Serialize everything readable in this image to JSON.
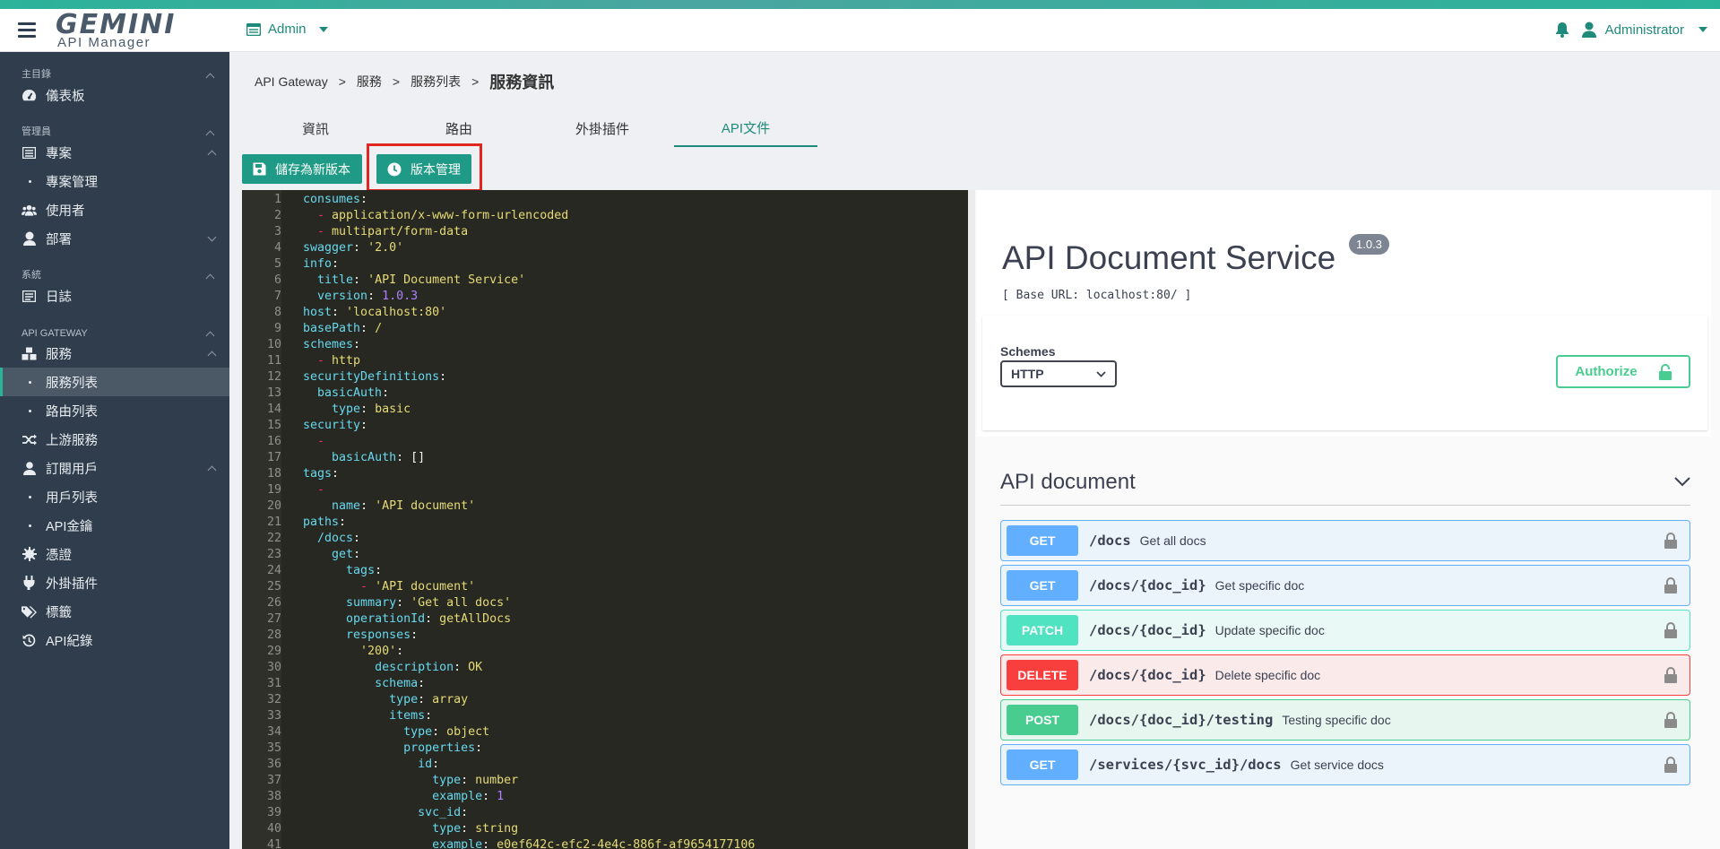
{
  "topbar": {
    "logo_main": "GEMINI",
    "logo_sub": "API Manager",
    "admin_label": "Admin",
    "user_label": "Administrator"
  },
  "sidebar": {
    "sections": [
      {
        "title": "主目錄"
      },
      {
        "title": "管理員"
      },
      {
        "title": "系統"
      },
      {
        "title": "API GATEWAY"
      }
    ],
    "items": {
      "dashboard": "儀表板",
      "projects": "專案",
      "project_mgmt": "專案管理",
      "users": "使用者",
      "departments": "部署",
      "logs": "日誌",
      "services": "服務",
      "service_list": "服務列表",
      "route_list": "路由列表",
      "upstream": "上游服務",
      "subscribers": "訂閱用戶",
      "user_list": "用戶列表",
      "api_key": "API金鑰",
      "certificates": "憑證",
      "plugins": "外掛插件",
      "tags": "標籤",
      "api_records": "API紀錄"
    }
  },
  "breadcrumb": {
    "items": [
      "API Gateway",
      "服務",
      "服務列表"
    ],
    "separator": ">",
    "current": "服務資訊"
  },
  "tabs": [
    "資訊",
    "路由",
    "外掛插件",
    "API文件"
  ],
  "buttons": {
    "save_new_version": "儲存為新版本",
    "version_management": "版本管理"
  },
  "editor": {
    "lines": [
      [
        [
          "k",
          "consumes"
        ],
        [
          "p",
          ":"
        ]
      ],
      [
        [
          "p",
          "  "
        ],
        [
          "dash",
          "- "
        ],
        [
          "s",
          "application/x-www-form-urlencoded"
        ]
      ],
      [
        [
          "p",
          "  "
        ],
        [
          "dash",
          "- "
        ],
        [
          "s",
          "multipart/form-data"
        ]
      ],
      [
        [
          "k",
          "swagger"
        ],
        [
          "p",
          ": "
        ],
        [
          "s",
          "'2.0'"
        ]
      ],
      [
        [
          "k",
          "info"
        ],
        [
          "p",
          ":"
        ]
      ],
      [
        [
          "p",
          "  "
        ],
        [
          "k",
          "title"
        ],
        [
          "p",
          ": "
        ],
        [
          "s",
          "'API Document Service'"
        ]
      ],
      [
        [
          "p",
          "  "
        ],
        [
          "k",
          "version"
        ],
        [
          "p",
          ": "
        ],
        [
          "v",
          "1.0.3"
        ]
      ],
      [
        [
          "k",
          "host"
        ],
        [
          "p",
          ": "
        ],
        [
          "s",
          "'localhost:80'"
        ]
      ],
      [
        [
          "k",
          "basePath"
        ],
        [
          "p",
          ": "
        ],
        [
          "s",
          "/"
        ]
      ],
      [
        [
          "k",
          "schemes"
        ],
        [
          "p",
          ":"
        ]
      ],
      [
        [
          "p",
          "  "
        ],
        [
          "dash",
          "- "
        ],
        [
          "s",
          "http"
        ]
      ],
      [
        [
          "k",
          "securityDefinitions"
        ],
        [
          "p",
          ":"
        ]
      ],
      [
        [
          "p",
          "  "
        ],
        [
          "k",
          "basicAuth"
        ],
        [
          "p",
          ":"
        ]
      ],
      [
        [
          "p",
          "    "
        ],
        [
          "k",
          "type"
        ],
        [
          "p",
          ": "
        ],
        [
          "s",
          "basic"
        ]
      ],
      [
        [
          "k",
          "security"
        ],
        [
          "p",
          ":"
        ]
      ],
      [
        [
          "p",
          "  "
        ],
        [
          "dash",
          "-"
        ]
      ],
      [
        [
          "p",
          "    "
        ],
        [
          "k",
          "basicAuth"
        ],
        [
          "p",
          ": []"
        ]
      ],
      [
        [
          "k",
          "tags"
        ],
        [
          "p",
          ":"
        ]
      ],
      [
        [
          "p",
          "  "
        ],
        [
          "dash",
          "-"
        ]
      ],
      [
        [
          "p",
          "    "
        ],
        [
          "k",
          "name"
        ],
        [
          "p",
          ": "
        ],
        [
          "s",
          "'API document'"
        ]
      ],
      [
        [
          "k",
          "paths"
        ],
        [
          "p",
          ":"
        ]
      ],
      [
        [
          "p",
          "  "
        ],
        [
          "k",
          "/docs"
        ],
        [
          "p",
          ":"
        ]
      ],
      [
        [
          "p",
          "    "
        ],
        [
          "k",
          "get"
        ],
        [
          "p",
          ":"
        ]
      ],
      [
        [
          "p",
          "      "
        ],
        [
          "k",
          "tags"
        ],
        [
          "p",
          ":"
        ]
      ],
      [
        [
          "p",
          "        "
        ],
        [
          "dash",
          "- "
        ],
        [
          "s",
          "'API document'"
        ]
      ],
      [
        [
          "p",
          "      "
        ],
        [
          "k",
          "summary"
        ],
        [
          "p",
          ": "
        ],
        [
          "s",
          "'Get all docs'"
        ]
      ],
      [
        [
          "p",
          "      "
        ],
        [
          "k",
          "operationId"
        ],
        [
          "p",
          ": "
        ],
        [
          "s",
          "getAllDocs"
        ]
      ],
      [
        [
          "p",
          "      "
        ],
        [
          "k",
          "responses"
        ],
        [
          "p",
          ":"
        ]
      ],
      [
        [
          "p",
          "        "
        ],
        [
          "s",
          "'200'"
        ],
        [
          "p",
          ":"
        ]
      ],
      [
        [
          "p",
          "          "
        ],
        [
          "k",
          "description"
        ],
        [
          "p",
          ": "
        ],
        [
          "s",
          "OK"
        ]
      ],
      [
        [
          "p",
          "          "
        ],
        [
          "k",
          "schema"
        ],
        [
          "p",
          ":"
        ]
      ],
      [
        [
          "p",
          "            "
        ],
        [
          "k",
          "type"
        ],
        [
          "p",
          ": "
        ],
        [
          "s",
          "array"
        ]
      ],
      [
        [
          "p",
          "            "
        ],
        [
          "k",
          "items"
        ],
        [
          "p",
          ":"
        ]
      ],
      [
        [
          "p",
          "              "
        ],
        [
          "k",
          "type"
        ],
        [
          "p",
          ": "
        ],
        [
          "s",
          "object"
        ]
      ],
      [
        [
          "p",
          "              "
        ],
        [
          "k",
          "properties"
        ],
        [
          "p",
          ":"
        ]
      ],
      [
        [
          "p",
          "                "
        ],
        [
          "k",
          "id"
        ],
        [
          "p",
          ":"
        ]
      ],
      [
        [
          "p",
          "                  "
        ],
        [
          "k",
          "type"
        ],
        [
          "p",
          ": "
        ],
        [
          "s",
          "number"
        ]
      ],
      [
        [
          "p",
          "                  "
        ],
        [
          "k",
          "example"
        ],
        [
          "p",
          ": "
        ],
        [
          "v",
          "1"
        ]
      ],
      [
        [
          "p",
          "                "
        ],
        [
          "k",
          "svc_id"
        ],
        [
          "p",
          ":"
        ]
      ],
      [
        [
          "p",
          "                  "
        ],
        [
          "k",
          "type"
        ],
        [
          "p",
          ": "
        ],
        [
          "s",
          "string"
        ]
      ],
      [
        [
          "p",
          "                  "
        ],
        [
          "k",
          "example"
        ],
        [
          "p",
          ": "
        ],
        [
          "s",
          "e0ef642c-efc2-4e4c-886f-af9654177106"
        ]
      ]
    ]
  },
  "swagger": {
    "title": "API Document Service",
    "version": "1.0.3",
    "base_url": "[ Base URL: localhost:80/ ]",
    "schemes_label": "Schemes",
    "schemes_value": "HTTP",
    "authorize_label": "Authorize",
    "tag_title": "API document",
    "operations": [
      {
        "method": "GET",
        "path": "/docs",
        "desc": "Get all docs",
        "cls": "get"
      },
      {
        "method": "GET",
        "path": "/docs/{doc_id}",
        "desc": "Get specific doc",
        "cls": "get"
      },
      {
        "method": "PATCH",
        "path": "/docs/{doc_id}",
        "desc": "Update specific doc",
        "cls": "patch"
      },
      {
        "method": "DELETE",
        "path": "/docs/{doc_id}",
        "desc": "Delete specific doc",
        "cls": "delete"
      },
      {
        "method": "POST",
        "path": "/docs/{doc_id}/testing",
        "desc": "Testing specific doc",
        "cls": "post"
      },
      {
        "method": "GET",
        "path": "/services/{svc_id}/docs",
        "desc": "Get service docs",
        "cls": "get"
      }
    ]
  },
  "colors": {
    "accent": "#1e9a86",
    "sidebar_bg": "#2f3d4c",
    "highlight": "#e0261e"
  }
}
